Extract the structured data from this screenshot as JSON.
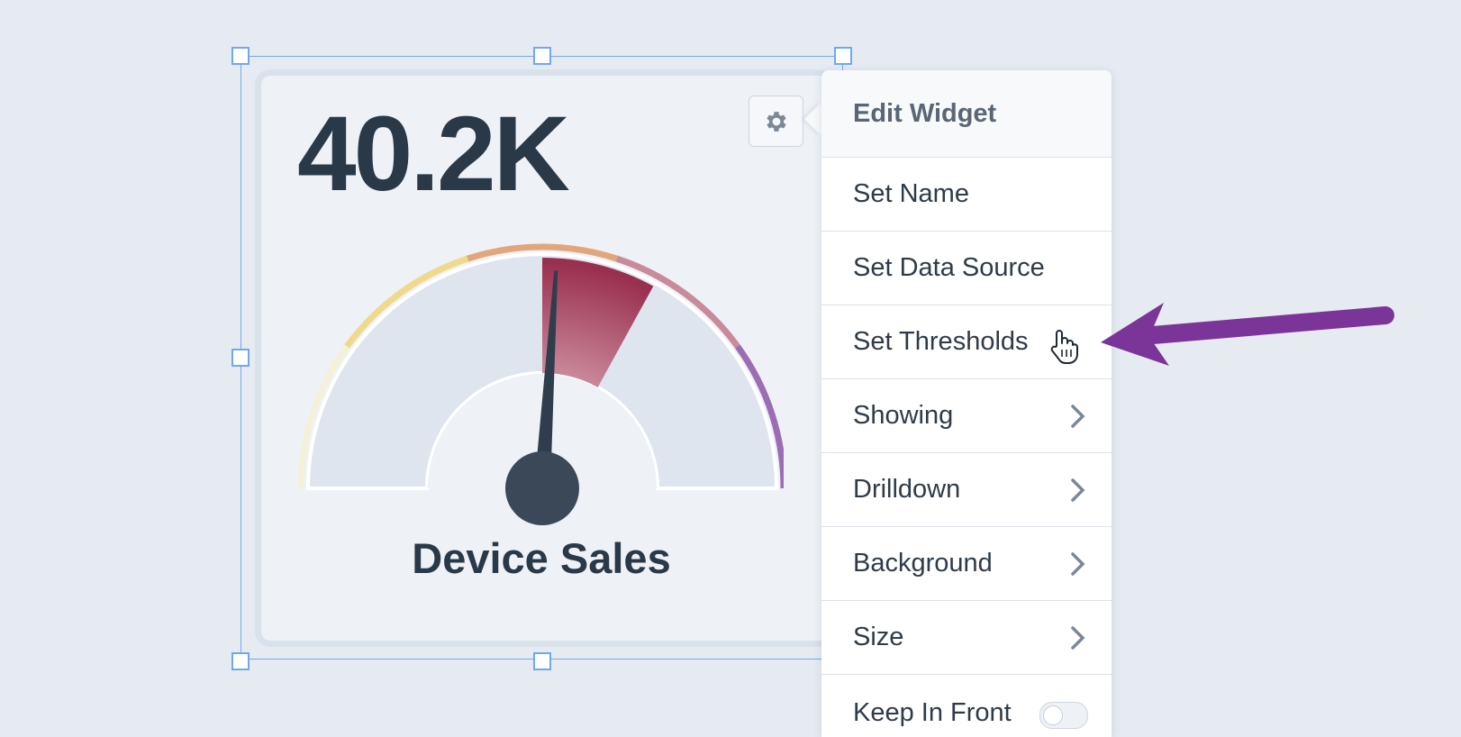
{
  "widget": {
    "value": "40.2K",
    "title": "Device Sales",
    "gauge": {
      "fraction": 0.52,
      "highlight_band_fraction": [
        0.5,
        0.66
      ],
      "threshold_colors": [
        "#f4f1d8",
        "#efd98a",
        "#e2a67c",
        "#c98a9c",
        "#9c6db5"
      ]
    }
  },
  "menu": {
    "header": "Edit Widget",
    "items": [
      {
        "label": "Set Name",
        "submenu": false
      },
      {
        "label": "Set Data Source",
        "submenu": false
      },
      {
        "label": "Set Thresholds",
        "submenu": false,
        "hovered": true
      },
      {
        "label": "Showing",
        "submenu": true
      },
      {
        "label": "Drilldown",
        "submenu": true
      },
      {
        "label": "Background",
        "submenu": true
      },
      {
        "label": "Size",
        "submenu": true
      },
      {
        "label": "Keep In Front",
        "toggle": false
      }
    ]
  },
  "colors": {
    "selection": "#6ea9ef",
    "annotation_arrow": "#7b3497",
    "needle": "#2f3d4c",
    "gauge_highlight": "#9a3050"
  }
}
